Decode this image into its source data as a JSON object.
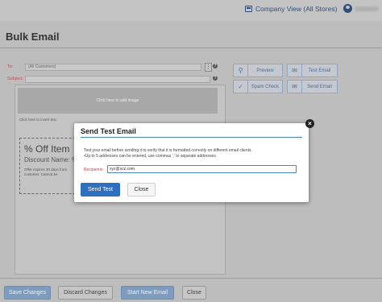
{
  "header": {
    "store_label": "Company View (All Stores)",
    "store_icon": "store-icon",
    "user_icon": "user-avatar-icon"
  },
  "page": {
    "title": "Bulk Email"
  },
  "form": {
    "to_label": "To:",
    "to_value": "(All Customers)",
    "subject_label": "Subject:",
    "subject_value": "",
    "kebab": "⋮",
    "help": "?"
  },
  "editor": {
    "add_image": "Click here to add image",
    "insert_text": "Click here to insert text",
    "coupon_title": "% Off Item",
    "coupon_discount": "Discount Name: %",
    "coupon_note": "Offer expires 30 days from customer. Cannot be"
  },
  "actions": {
    "preview": "Preview",
    "test_email": "Test Email",
    "spam_check": "Spam Check",
    "send_email": "Send Email"
  },
  "footer": {
    "save": "Save Changes",
    "discard": "Discard Changes",
    "start_new": "Start New Email",
    "close": "Close"
  },
  "modal": {
    "title": "Send Test Email",
    "message_1": "Test your email before sending it to verify that it is formatted correctly on different email clients.",
    "message_2": "•Up to 5 addresses can be entered, use commas ',' to separate addresses.",
    "recipients_label": "Recipients:",
    "recipients_value": "xyz@xcz.com",
    "send_test": "Send Test",
    "close": "Close",
    "close_icon": "×"
  },
  "colors": {
    "accent": "#2f6fc0",
    "required_label": "#c24a4a",
    "secondary_button_text": "#4d6c93"
  }
}
